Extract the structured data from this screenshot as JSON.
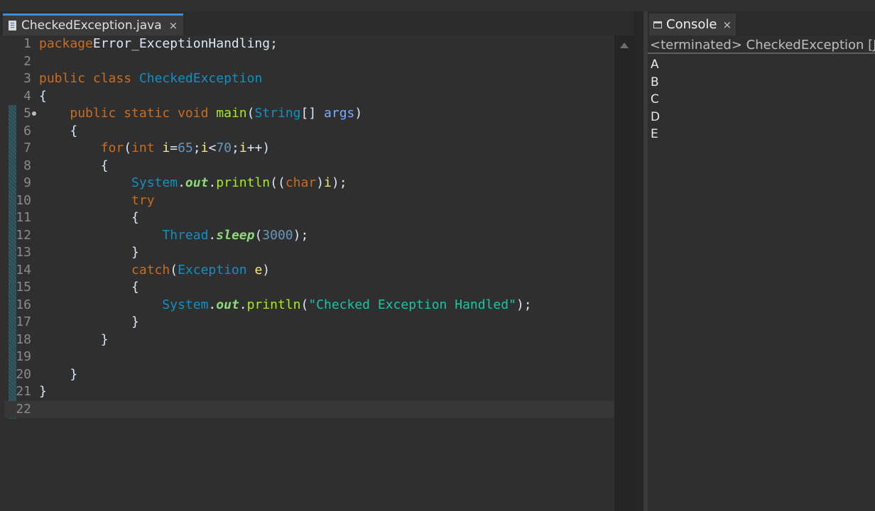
{
  "editor": {
    "tab_label": "CheckedException.java",
    "tab_close": "×",
    "lines": [
      {
        "n": "1",
        "t": [
          [
            "kw",
            "package"
          ],
          [
            "",
            "Error_ExceptionHandling;"
          ]
        ]
      },
      {
        "n": "2",
        "t": []
      },
      {
        "n": "3",
        "t": [
          [
            "kw",
            "public class "
          ],
          [
            "cls",
            "CheckedException"
          ]
        ]
      },
      {
        "n": "4",
        "t": [
          [
            "",
            "{"
          ]
        ]
      },
      {
        "n": "5",
        "t": [
          [
            "",
            "    "
          ],
          [
            "kw",
            "public static void "
          ],
          [
            "fn",
            "main"
          ],
          [
            "",
            "("
          ],
          [
            "ty",
            "String"
          ],
          [
            "",
            "[] "
          ],
          [
            "prm",
            "args"
          ],
          [
            "",
            ")"
          ]
        ]
      },
      {
        "n": "6",
        "t": [
          [
            "",
            "    {"
          ]
        ]
      },
      {
        "n": "7",
        "t": [
          [
            "",
            "        "
          ],
          [
            "kw",
            "for"
          ],
          [
            "",
            "("
          ],
          [
            "kw",
            "int "
          ],
          [
            "var",
            "i"
          ],
          [
            "",
            "="
          ],
          [
            "num",
            "65"
          ],
          [
            "",
            ";"
          ],
          [
            "var",
            "i"
          ],
          [
            "",
            "<"
          ],
          [
            "num",
            "70"
          ],
          [
            "",
            ";"
          ],
          [
            "var",
            "i"
          ],
          [
            "",
            "++)"
          ]
        ]
      },
      {
        "n": "8",
        "t": [
          [
            "",
            "        {"
          ]
        ]
      },
      {
        "n": "9",
        "t": [
          [
            "",
            "            "
          ],
          [
            "ty",
            "System"
          ],
          [
            "",
            "."
          ],
          [
            "fld",
            "out"
          ],
          [
            "",
            "."
          ],
          [
            "fn",
            "println"
          ],
          [
            "",
            "(("
          ],
          [
            "kw",
            "char"
          ],
          [
            "",
            ")"
          ],
          [
            "var",
            "i"
          ],
          [
            "",
            ");"
          ]
        ]
      },
      {
        "n": "10",
        "t": [
          [
            "",
            "            "
          ],
          [
            "kw",
            "try"
          ]
        ]
      },
      {
        "n": "11",
        "t": [
          [
            "",
            "            {"
          ]
        ]
      },
      {
        "n": "12",
        "t": [
          [
            "",
            "                "
          ],
          [
            "ty",
            "Thread"
          ],
          [
            "",
            "."
          ],
          [
            "fld",
            "sleep"
          ],
          [
            "",
            "("
          ],
          [
            "num",
            "3000"
          ],
          [
            "",
            ");"
          ]
        ]
      },
      {
        "n": "13",
        "t": [
          [
            "",
            "            }"
          ]
        ]
      },
      {
        "n": "14",
        "t": [
          [
            "",
            "            "
          ],
          [
            "kw",
            "catch"
          ],
          [
            "",
            "("
          ],
          [
            "ty",
            "Exception "
          ],
          [
            "var",
            "e"
          ],
          [
            "",
            ")"
          ]
        ]
      },
      {
        "n": "15",
        "t": [
          [
            "",
            "            {"
          ]
        ]
      },
      {
        "n": "16",
        "t": [
          [
            "",
            "                "
          ],
          [
            "ty",
            "System"
          ],
          [
            "",
            "."
          ],
          [
            "fld",
            "out"
          ],
          [
            "",
            "."
          ],
          [
            "fn",
            "println"
          ],
          [
            "",
            "("
          ],
          [
            "str",
            "\"Checked Exception Handled\""
          ],
          [
            "",
            ");"
          ]
        ]
      },
      {
        "n": "17",
        "t": [
          [
            "",
            "            }"
          ]
        ]
      },
      {
        "n": "18",
        "t": [
          [
            "",
            "        }"
          ]
        ]
      },
      {
        "n": "19",
        "t": []
      },
      {
        "n": "20",
        "t": [
          [
            "",
            "    }"
          ]
        ]
      },
      {
        "n": "21",
        "t": [
          [
            "",
            "}"
          ]
        ]
      },
      {
        "n": "22",
        "t": []
      }
    ]
  },
  "console": {
    "tab_label": "Console",
    "tab_close": "×",
    "header": "<terminated> CheckedException [Java Application]",
    "output": [
      "A",
      "B",
      "C",
      "D",
      "E"
    ]
  },
  "colors": {
    "keyword": "#cc6c1d",
    "type": "#1290c3",
    "method": "#a7ec21",
    "local": "#f3ec79",
    "param": "#79abff",
    "number": "#6897bb",
    "string": "#17c6a3",
    "field": "#8dda7a"
  }
}
